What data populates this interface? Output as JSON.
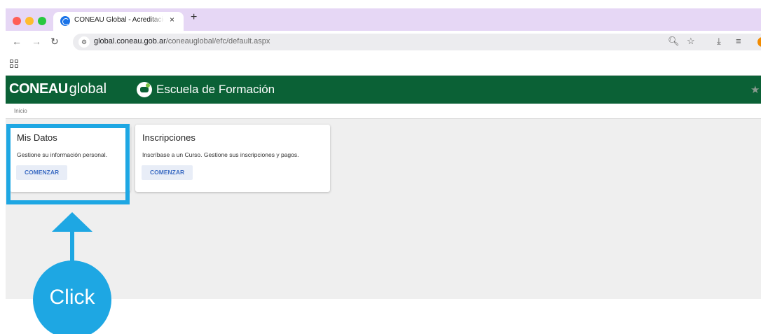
{
  "browser": {
    "tab_title": "CONEAU Global - Acreditació",
    "tab_close": "×",
    "new_tab": "+",
    "url_host": "global.coneau.gob.ar",
    "url_path": "/coneauglobal/efc/default.aspx",
    "icons": [
      "back-arrow-icon",
      "forward-arrow-icon",
      "reload-icon",
      "site-info-icon",
      "zoom-icon",
      "bookmark-star-icon",
      "download-icon",
      "reading-list-icon",
      "profile-avatar-icon",
      "apps-grid-icon"
    ]
  },
  "site": {
    "logo_bold": "CONEAU",
    "logo_light": "global",
    "school_title": "Escuela de Formación",
    "header_color": "#0b6136"
  },
  "breadcrumb": {
    "label": "Inicio"
  },
  "cards": [
    {
      "title": "Mis Datos",
      "text": "Gestione su información personal.",
      "button": "COMENZAR"
    },
    {
      "title": "Inscripciones",
      "text": "Inscríbase a un Curso. Gestione sus inscripciones y pagos.",
      "button": "COMENZAR"
    }
  ],
  "annotation": {
    "label": "Click",
    "color": "#1ea7e3"
  }
}
